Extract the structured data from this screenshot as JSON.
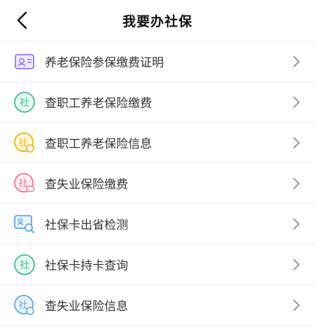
{
  "header": {
    "title": "我要办社保"
  },
  "items": [
    {
      "label": "养老保险参保缴费证明",
      "icon": "id-card-icon",
      "badge": "",
      "color": "#8a7df0"
    },
    {
      "label": "查职工养老保险缴费",
      "icon": "social-security-coin-icon",
      "badge": "社",
      "color": "#3fbf8a"
    },
    {
      "label": "查职工养老保险信息",
      "icon": "social-security-info-icon",
      "badge": "社",
      "color": "#f0b400"
    },
    {
      "label": "查失业保险缴费",
      "icon": "social-security-unemployment-icon",
      "badge": "社",
      "color": "#f07a8a"
    },
    {
      "label": "社保卡出省检测",
      "icon": "card-search-icon",
      "badge": "",
      "color": "#5aa7f0"
    },
    {
      "label": "社保卡持卡查询",
      "icon": "social-security-card-icon",
      "badge": "社",
      "color": "#3fbf8a"
    },
    {
      "label": "查失业保险信息",
      "icon": "social-security-unemployment-info-icon",
      "badge": "社",
      "color": "#5aa7f0"
    }
  ]
}
